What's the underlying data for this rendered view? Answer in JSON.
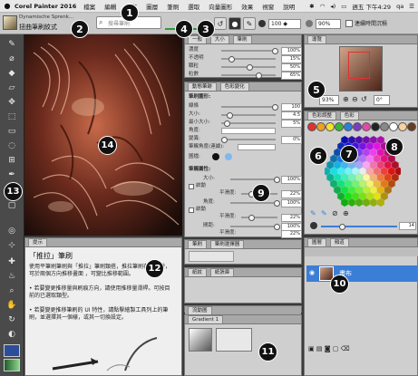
{
  "menubar": {
    "apple_icon": "",
    "app_name": "Corel Painter 2016",
    "items": [
      "檔案",
      "編輯",
      "畫布",
      "圖層",
      "筆刷",
      "選取",
      "向量圖形",
      "效果",
      "視窗",
      "說明"
    ],
    "clock": "週五 下午4:29",
    "user": "qa"
  },
  "propbar": {
    "brush_category": "Dynamische Sprenk...",
    "brush_variant": "扭曲筆刷紋式",
    "search_placeholder": "搜尋筆刷",
    "size_value": "100 ◆",
    "opacity_value": "90%",
    "checkbox_label": "連續時間沉積"
  },
  "panels": {
    "general": {
      "tabs": [
        "一般",
        "大小",
        "筆刷"
      ],
      "rows": [
        {
          "label": "濃度",
          "value": "100%"
        },
        {
          "label": "不透明",
          "value": "15%"
        },
        {
          "label": "顆粒",
          "value": "50%"
        },
        {
          "label": "粒數",
          "value": "65%"
        }
      ]
    },
    "dynamic": {
      "tabs": [
        "動態筆跡",
        "色彩變化"
      ],
      "heading": "筆刷圖形:",
      "rows": [
        {
          "label": "線條",
          "value": "100"
        },
        {
          "label": "大小:",
          "value": "4.5"
        },
        {
          "label": "最小大小:",
          "value": "5%"
        },
        {
          "label": "角度:",
          "value": ""
        },
        {
          "label": "變異:",
          "value": "0%"
        },
        {
          "label": "筆觸角度(連續):",
          "value": ""
        },
        {
          "label": "圖檔:",
          "value": ""
        }
      ]
    },
    "stroke": {
      "heading": "筆觸屬性:",
      "rows": [
        {
          "label": "大小:",
          "value": "100%"
        },
        {
          "label": "平滑度:",
          "value": "22%"
        },
        {
          "label": "角度:",
          "value": "100%"
        },
        {
          "label": "平滑度:",
          "value": "22%"
        },
        {
          "label": "間距:",
          "value": "100%"
        },
        {
          "label": "平滑度:",
          "value": "22%"
        }
      ],
      "checks": [
        "啟動",
        "啟動",
        "啟動"
      ]
    },
    "brush_panels": {
      "tabs": [
        "筆刷",
        "筆刷選擇器"
      ]
    },
    "library": {
      "tabs": [
        "紙紋",
        "紙張庫"
      ]
    },
    "flow": {
      "tabs": [
        "流動圖"
      ]
    },
    "gradients": {
      "tabs": [
        "Gradient 1"
      ]
    },
    "navigator": {
      "tabs": [
        "導覽"
      ],
      "zoom": "93%",
      "rotation": "0°"
    },
    "color": {
      "tabs": [
        "色彩調整",
        "色彩"
      ],
      "value": "14"
    },
    "layers": {
      "tabs": [
        "圖層",
        "頻道"
      ],
      "layer_name": "畫布"
    }
  },
  "help": {
    "tab": "提示",
    "title": "「推拉」筆刷",
    "paragraphs": [
      "使用平筆刷筆刷與「推拉」筆刷類搭，推拉筆刷在操作時，可於兩個方向推移畫面 ，可變比推移範圍。",
      "• 若要變更推移量與刷痕方向，請使用推移量滑桿。可按目前的已選取類型。",
      "• 若要變更推移筆刷的 UI 特性，請點擊繪製工具列上的筆刷，並選擇其一個樣，或其一切換設定。"
    ]
  },
  "markers": [
    "1",
    "2",
    "3",
    "4",
    "5",
    "6",
    "7",
    "8",
    "9",
    "10",
    "11",
    "12",
    "13",
    "14"
  ],
  "colors": {
    "menubar_bg": "#e8e8e8",
    "panel_bg": "#cfcfcf",
    "marker_bg": "#111111",
    "accent_green": "#2e9b3d",
    "accent_blue": "#3b7ed6"
  },
  "palette": [
    "#e23030",
    "#f0a020",
    "#f4e22c",
    "#3cb43c",
    "#2f7fd9",
    "#7b3cc4",
    "#e04ca6",
    "#222222",
    "#888888",
    "#ffffff",
    "#f7d3a0",
    "#6b3d1f"
  ]
}
